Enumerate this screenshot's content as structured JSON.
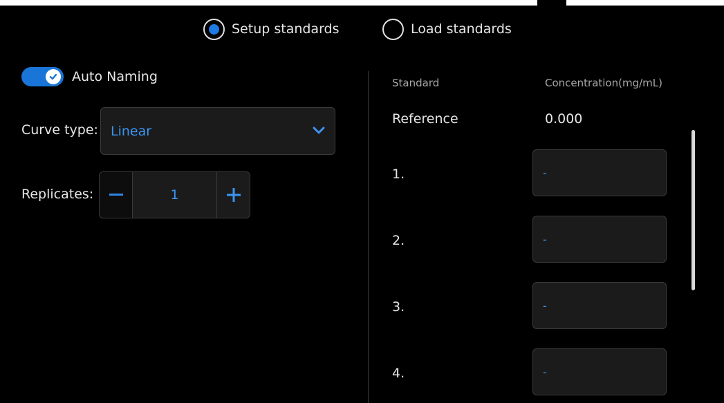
{
  "mode_radio": {
    "options": [
      {
        "label": "Setup standards",
        "selected": true
      },
      {
        "label": "Load standards",
        "selected": false
      }
    ],
    "accent_color": "#1e7be6"
  },
  "auto_naming": {
    "label": "Auto Naming",
    "enabled": true
  },
  "curve_type": {
    "label": "Curve type:",
    "value": "Linear"
  },
  "replicates": {
    "label": "Replicates:",
    "value": "1"
  },
  "standards_table": {
    "headers": {
      "standard": "Standard",
      "concentration": "Concentration(mg/mL)"
    },
    "reference": {
      "name": "Reference",
      "concentration": "0.000"
    },
    "rows": [
      {
        "name": "1.",
        "concentration": "-"
      },
      {
        "name": "2.",
        "concentration": "-"
      },
      {
        "name": "3.",
        "concentration": "-"
      },
      {
        "name": "4.",
        "concentration": "-"
      }
    ]
  },
  "colors": {
    "value_text": "#3b95f2",
    "toggle_on": "#1976d8",
    "field_bg": "#1b1b1b"
  }
}
